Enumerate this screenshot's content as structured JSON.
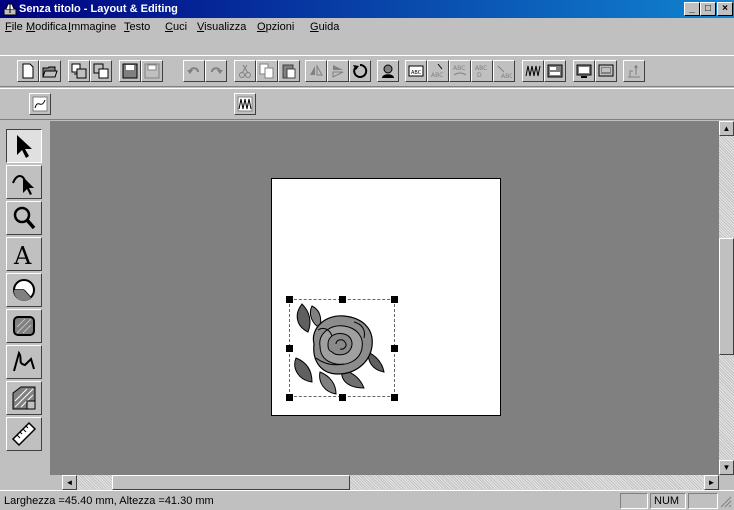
{
  "window": {
    "title": "Senza titolo - Layout & Editing"
  },
  "menu": [
    {
      "label": "File",
      "accel": "F",
      "rest": "ile"
    },
    {
      "label": "Modifica",
      "accel": "M",
      "rest": "odifica"
    },
    {
      "label": "Immagine",
      "accel": "I",
      "rest": "mmagine"
    },
    {
      "label": "Testo",
      "accel": "T",
      "rest": "esto"
    },
    {
      "label": "Cuci",
      "accel": "C",
      "rest": "uci"
    },
    {
      "label": "Visualizza",
      "accel": "V",
      "rest": "isualizza"
    },
    {
      "label": "Opzioni",
      "accel": "O",
      "rest": "pzioni"
    },
    {
      "label": "Guida",
      "accel": "G",
      "rest": "uida"
    }
  ],
  "toolbar_buttons": [
    "new",
    "open",
    "import",
    "export",
    "save",
    "save-as",
    "undo",
    "redo",
    "cut",
    "copy",
    "paste",
    "mirror-h",
    "mirror-v",
    "rotate",
    "user",
    "text-frame",
    "text-mode",
    "abc-1",
    "abc-2",
    "abc-3",
    "stitch-pattern",
    "stitch-settings",
    "monitor",
    "display",
    "sewing"
  ],
  "toolbar2_buttons": [
    "curve",
    "stitch-pattern"
  ],
  "tools": [
    "select-arrow",
    "edit-points",
    "zoom",
    "text",
    "circle-arc",
    "rectangle",
    "outline",
    "stitch-area",
    "measure"
  ],
  "status": {
    "text": "Larghezza  =45.40 mm, Altezza =41.30 mm",
    "num": "NUM"
  },
  "colors": {
    "title_start": "#000080",
    "title_end": "#1084d0",
    "face": "#c0c0c0",
    "canvas": "#808080"
  }
}
